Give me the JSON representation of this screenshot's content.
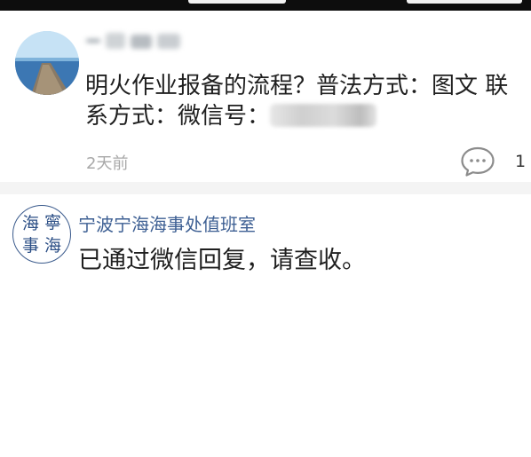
{
  "post": {
    "username": "",
    "text_part1": "明火作业报备的流程？普法方式：图文 联系方式：微信号：",
    "text_part2": "",
    "time": "2天前",
    "comment_count": "1",
    "icons": {
      "comment": "comment-bubble-icon",
      "avatar": "avatar-seaside-pier"
    }
  },
  "reply": {
    "seal_chars": [
      "海",
      "寧",
      "事",
      "海"
    ],
    "name": "宁波宁海海事处值班室",
    "text": "已通过微信回复，请查收。"
  },
  "colors": {
    "reply_name": "#3d5f93",
    "time": "#a8a8a8",
    "seal": "#2c4f86",
    "divider": "#f4f4f4"
  }
}
